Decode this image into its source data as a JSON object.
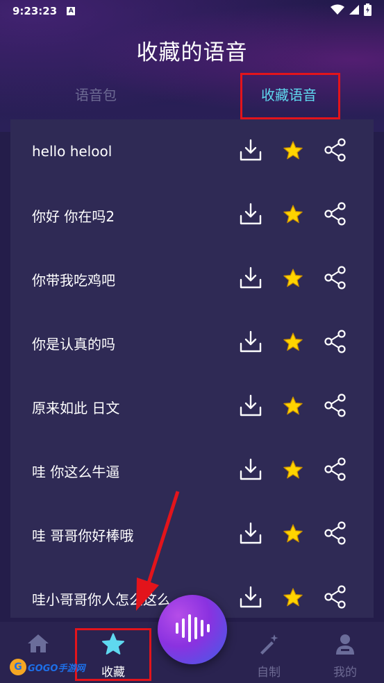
{
  "status": {
    "time": "9:23:23",
    "notice_badge": "A",
    "icons": [
      "wifi-icon",
      "signal-icon",
      "battery-icon"
    ]
  },
  "header": {
    "title": "收藏的语音"
  },
  "tabs": [
    {
      "label": "语音包",
      "active": false
    },
    {
      "label": "收藏语音",
      "active": true
    }
  ],
  "favorites": [
    {
      "text": "hello helool",
      "starred": true
    },
    {
      "text": "你好 你在吗2",
      "starred": true
    },
    {
      "text": "你带我吃鸡吧",
      "starred": true
    },
    {
      "text": "你是认真的吗",
      "starred": true
    },
    {
      "text": "原来如此 日文",
      "starred": true
    },
    {
      "text": "哇 你这么牛逼",
      "starred": true
    },
    {
      "text": "哇 哥哥你好棒哦",
      "starred": true
    },
    {
      "text": "哇小哥哥你人怎么这么",
      "starred": true
    }
  ],
  "row_icons": [
    "download-icon",
    "star-icon",
    "share-icon"
  ],
  "bottom_nav": [
    {
      "label": "",
      "icon": "home-icon",
      "active": false
    },
    {
      "label": "收藏",
      "icon": "star-icon",
      "active": true
    },
    {
      "label": "自制",
      "icon": "magic-wand-icon",
      "active": false
    },
    {
      "label": "我的",
      "icon": "user-icon",
      "active": false
    }
  ],
  "fab": {
    "icon": "voice-wave-icon"
  },
  "watermark": {
    "text": "GOGO手游网"
  },
  "colors": {
    "background": "#241d4a",
    "panel": "#2f2a55",
    "accent": "#5fd8ef",
    "star": "#ffd400",
    "highlight_red": "#e3141b",
    "nav_inactive": "#6d6a93"
  }
}
